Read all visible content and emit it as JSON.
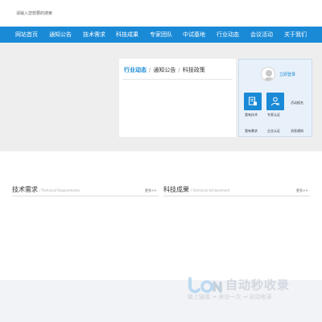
{
  "header": {
    "search_hint": "请输入您想要的搜索"
  },
  "nav": {
    "items": [
      {
        "label": "网站首页"
      },
      {
        "label": "通知公告"
      },
      {
        "label": "技术需求"
      },
      {
        "label": "科技成果"
      },
      {
        "label": "专家团队"
      },
      {
        "label": "中试基地"
      },
      {
        "label": "行业动态"
      },
      {
        "label": "会议活动"
      },
      {
        "label": "关于我们"
      }
    ]
  },
  "news": {
    "tabs": [
      {
        "label": "行业动态"
      },
      {
        "label": "通知公告"
      },
      {
        "label": "科技政策"
      }
    ],
    "separator": "/"
  },
  "user_panel": {
    "login": "立即登录",
    "services": [
      {
        "label": "我有技术",
        "icon": "document-icon"
      },
      {
        "label": "专家认证",
        "icon": "user-check-icon"
      }
    ],
    "activity": "活动报名",
    "links": [
      "我有需求",
      "企业认证",
      "消息通知"
    ]
  },
  "sections": [
    {
      "title": "技术需求",
      "subtitle": "/ Technical Requirements",
      "more": "更多>>"
    },
    {
      "title": "科技成果",
      "subtitle": "/ Technical Achievement",
      "more": "更多>>"
    }
  ],
  "watermark": {
    "title": "自动秒收录",
    "subtitle": "做上链接 → 来访一次 → 自动收录"
  },
  "colors": {
    "brand_blue": "#1a8ad7",
    "panel_bg": "#e8f1fa",
    "hero_bg": "#eeeeee"
  }
}
